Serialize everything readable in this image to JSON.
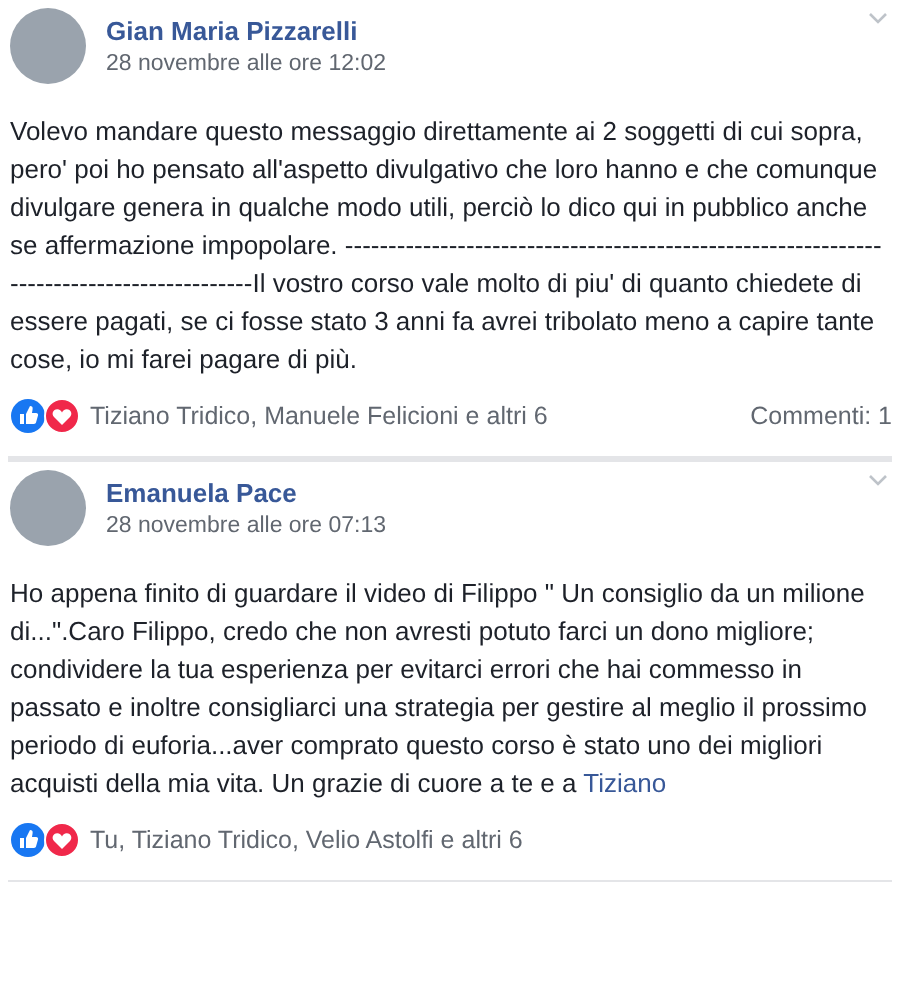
{
  "posts": [
    {
      "author": "Gian Maria Pizzarelli",
      "time": "28 novembre alle ore 12:02",
      "body": "Volevo mandare questo messaggio direttamente ai 2 soggetti di cui sopra, pero' poi ho pensato all'aspetto divulgativo che loro hanno e che comunque divulgare genera in qualche modo utili, perciò lo dico qui in pubblico anche se affermazione impopolare. ------------------------------------------------------------------------------------------Il vostro corso vale molto di piu' di quanto chiedete di essere pagati, se ci fosse stato 3 anni fa avrei tribolato meno a capire tante cose, io mi farei pagare di più.",
      "reactions": "Tiziano Tridico, Manuele Felicioni e altri 6",
      "comments": "Commenti: 1"
    },
    {
      "author": "Emanuela Pace",
      "time": "28 novembre alle ore 07:13",
      "body": "Ho appena finito di guardare il video di Filippo \" Un consiglio da un milione di...\".Caro Filippo, credo che non avresti potuto farci un dono migliore; condividere la tua esperienza per evitarci errori che hai commesso in passato e inoltre consigliarci una strategia per gestire al meglio il prossimo periodo di euforia...aver comprato questo corso è stato uno dei migliori acquisti della mia vita. Un grazie di cuore a te e a ",
      "mention": "Tiziano",
      "reactions": "Tu, Tiziano Tridico, Velio Astolfi e altri 6"
    }
  ]
}
